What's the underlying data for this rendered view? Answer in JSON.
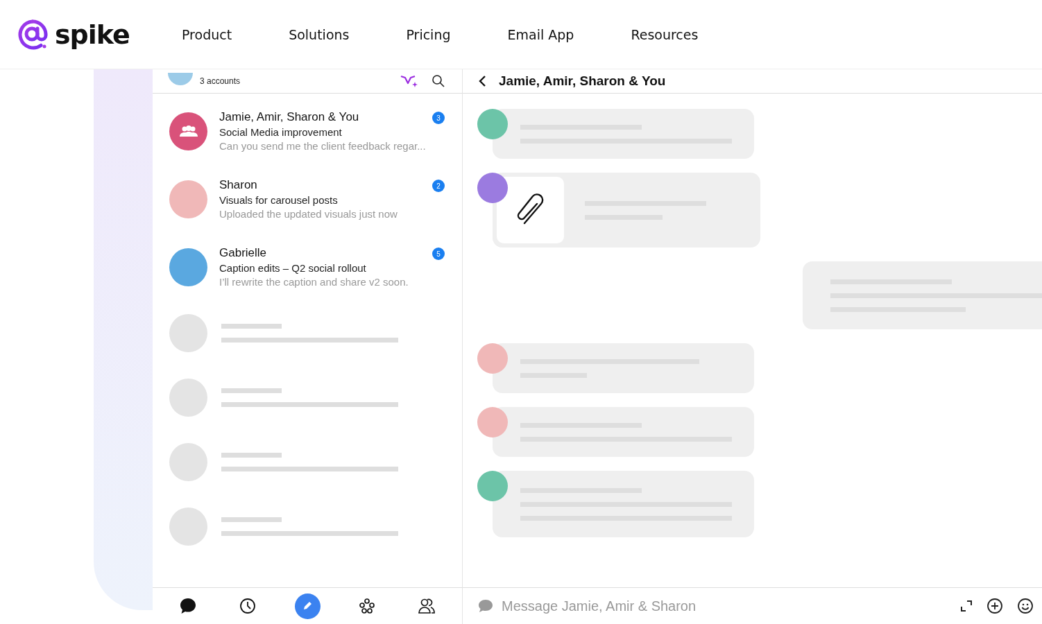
{
  "brand": {
    "name": "spike"
  },
  "nav": [
    "Product",
    "Solutions",
    "Pricing",
    "Email App",
    "Resources"
  ],
  "account": {
    "subtitle": "3 accounts"
  },
  "conversations": [
    {
      "kind": "group",
      "title": "Jamie, Amir, Sharon & You",
      "subject": "Social Media improvement",
      "preview": "Can you send me the client feedback regar...",
      "unread": "3",
      "color": "#d9527a"
    },
    {
      "kind": "person",
      "title": "Sharon",
      "subject": "Visuals for carousel posts",
      "preview": "Uploaded the updated visuals just now",
      "unread": "2",
      "color": "#f0b8b8"
    },
    {
      "kind": "person",
      "title": "Gabrielle",
      "subject": "Caption edits – Q2 social rollout",
      "preview": "I’ll rewrite the caption and share v2 soon.",
      "unread": "5",
      "color": "#5aa8e0"
    }
  ],
  "chat": {
    "title": "Jamie, Amir, Sharon & You",
    "placeholder": "Message Jamie, Amir & Sharon",
    "messages": [
      {
        "kind": "text",
        "color": "#6cc4a8"
      },
      {
        "kind": "attachment",
        "color": "#9b7be0"
      },
      {
        "kind": "outgoing"
      },
      {
        "kind": "text",
        "color": "#f0b8b8"
      },
      {
        "kind": "text",
        "color": "#f0b8b8"
      },
      {
        "kind": "long",
        "color": "#6cc4a8"
      }
    ]
  },
  "tabbar": [
    {
      "kind": "chat",
      "selected": false
    },
    {
      "kind": "clock",
      "selected": false
    },
    {
      "kind": "compose",
      "selected": true
    },
    {
      "kind": "groups",
      "selected": false
    },
    {
      "kind": "contacts",
      "selected": false
    }
  ]
}
